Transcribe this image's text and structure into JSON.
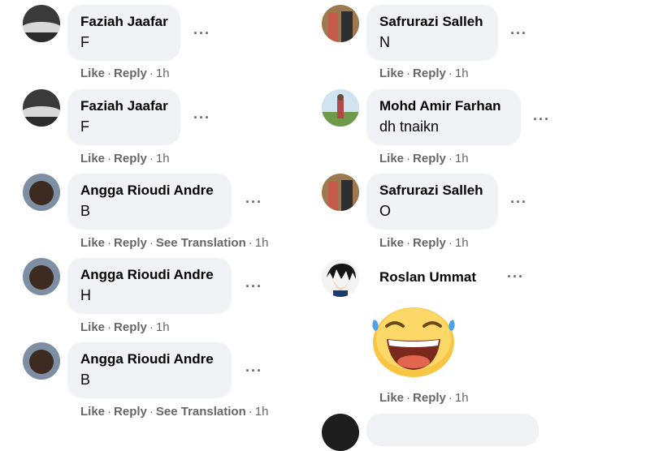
{
  "labels": {
    "like": "Like",
    "reply": "Reply",
    "see_translation": "See Translation",
    "dot": "·",
    "more": "···"
  },
  "left_comments": [
    {
      "author": "Faziah Jaafar",
      "text": "F",
      "time": "1h"
    },
    {
      "author": "Faziah Jaafar",
      "text": "F",
      "time": "1h"
    },
    {
      "author": "Angga Rioudi Andre",
      "text": "B",
      "time": "1h"
    },
    {
      "author": "Angga Rioudi Andre",
      "text": "H",
      "time": "1h"
    },
    {
      "author": "Angga Rioudi Andre",
      "text": "B",
      "time": "1h"
    }
  ],
  "right_comments": [
    {
      "author": "Safrurazi Salleh",
      "text": "N",
      "time": "1h"
    },
    {
      "author": "Mohd Amir Farhan",
      "text": "dh tnaikn",
      "time": "1h"
    },
    {
      "author": "Safrurazi Salleh",
      "text": "O",
      "time": "1h"
    },
    {
      "author": "Roslan Ummat",
      "sticker": "laughing-tears-emoji",
      "time": "1h"
    }
  ],
  "colors": {
    "bubble": "#f0f2f5",
    "meta_text": "#65676b",
    "author_text": "#050505"
  }
}
